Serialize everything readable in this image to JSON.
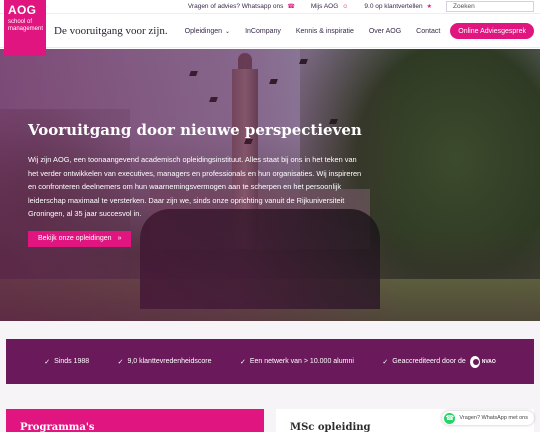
{
  "topbar": {
    "advice": "Vragen of advies? Whatsapp ons",
    "my_aog": "Mijs AOG",
    "rating": "9.0 op klantvertellen",
    "search_placeholder": "Zoeken"
  },
  "logo": {
    "name": "AOG",
    "sub_line1": "school of",
    "sub_line2": "management"
  },
  "header": {
    "tagline": "De vooruitgang voor zijn.",
    "nav": [
      "Opleidingen",
      "InCompany",
      "Kennis & inspiratie",
      "Over AOG",
      "Contact"
    ],
    "cta": "Online Adviesgesprek"
  },
  "hero": {
    "title": "Vooruitgang door nieuwe perspectieven",
    "text": "Wij zijn AOG, een toonaangevend academisch opleidingsinstituut. Alles staat bij ons in het teken van het verder ontwikkelen van executives, managers en professionals en hun organisaties. Wij inspireren en confronteren deelnemers om hun waarnemingsvermogen aan te scherpen en het persoonlijk leiderschap maximaal te versterken. Daar zijn we, sinds onze oprichting vanuit de Rijkuniversiteit Groningen, al 35 jaar succesvol in.",
    "button": "Bekijk onze opleidingen"
  },
  "stats": {
    "items": [
      "Sinds 1988",
      "9,0 klanttevredenheidscore",
      "Een netwerk van > 10.000 alumni",
      "Geaccrediteerd door de"
    ],
    "nvao": "NVAO"
  },
  "cards": {
    "left_title": "Programma's",
    "right_title": "MSc opleiding"
  },
  "whatsapp": {
    "label": "Vragen? WhatsApp met ons"
  },
  "colors": {
    "brand": "#e0157f",
    "purple": "#6a1a5b"
  },
  "icons": {
    "whatsapp": "whatsapp-icon",
    "user": "user-icon",
    "star": "star-icon",
    "search": "search-icon",
    "check": "check-icon",
    "chevron": "chevron-down-icon"
  }
}
